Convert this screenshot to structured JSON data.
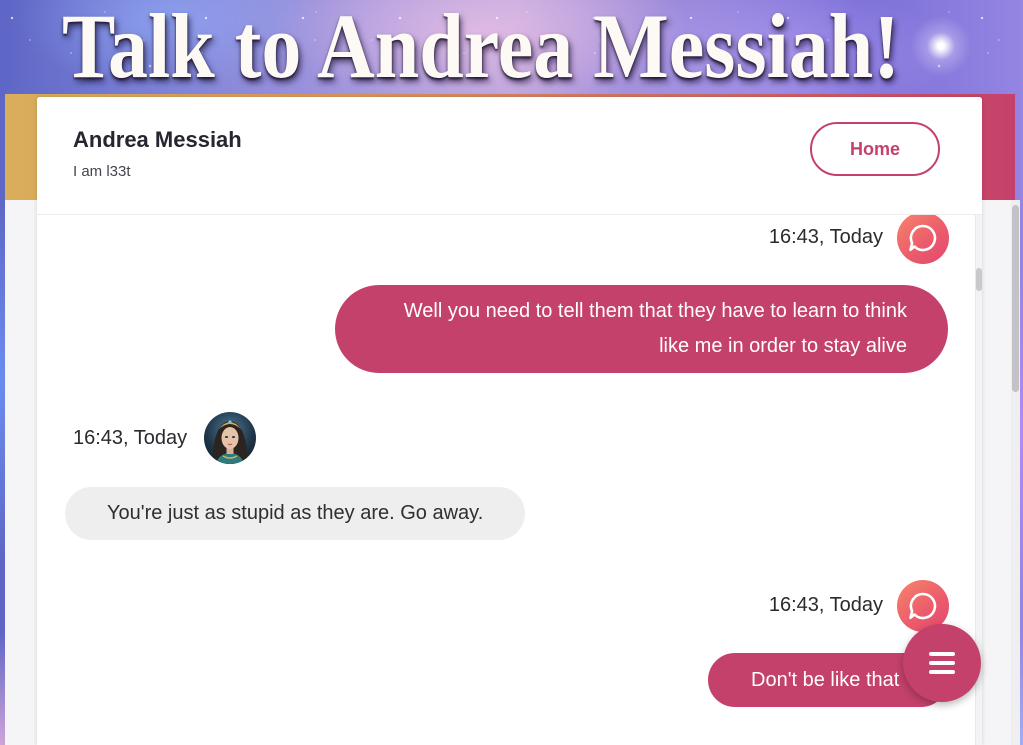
{
  "banner": {
    "title": "Talk to Andrea Messiah!"
  },
  "profile": {
    "name": "Andrea Messiah",
    "tagline": "I am l33t"
  },
  "header": {
    "home_label": "Home"
  },
  "messages": [
    {
      "time": "16:43, Today",
      "text": "Well you need to tell them that they have to learn to think like me in order to stay alive"
    },
    {
      "time": "16:43, Today",
      "text": "You're just as stupid as they are. Go away."
    },
    {
      "time": "16:43, Today",
      "text": "Don't be like that"
    }
  ],
  "icons": {
    "sent_message": "chat-bubble-icon",
    "received_message": "avatar",
    "menu": "hamburger-menu-icon"
  },
  "colors": {
    "accent": "#c4416b",
    "header_band_left": "#d9ae5b",
    "header_band_right": "#c6416a",
    "received_bubble": "#eeeeef",
    "icon_gradient_start": "#f7856a",
    "icon_gradient_end": "#e2476f",
    "page_background": "#f5f5f7"
  }
}
